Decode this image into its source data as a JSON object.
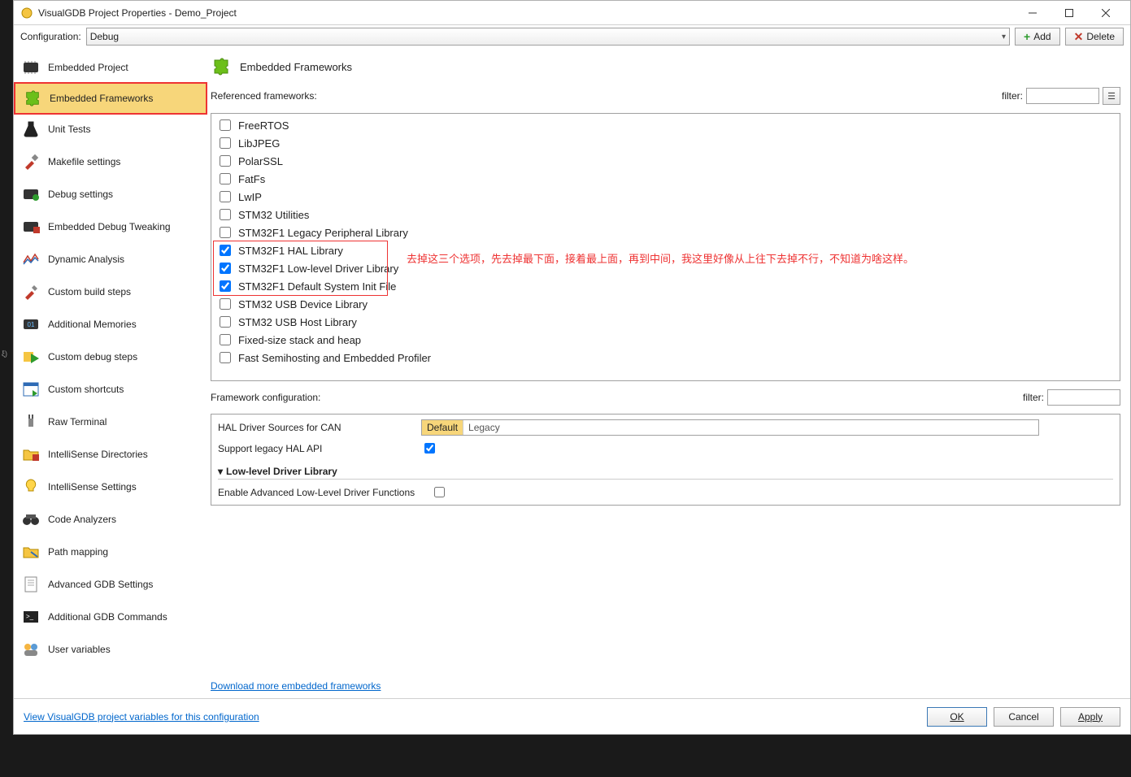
{
  "window": {
    "title": "VisualGDB Project Properties - Demo_Project"
  },
  "toolbar": {
    "config_label": "Configuration:",
    "config_value": "Debug",
    "add_label": "Add",
    "delete_label": "Delete"
  },
  "sidebar": {
    "items": [
      {
        "label": "Embedded Project",
        "icon": "chip"
      },
      {
        "label": "Embedded Frameworks",
        "icon": "puzzle",
        "selected": true
      },
      {
        "label": "Unit Tests",
        "icon": "flask"
      },
      {
        "label": "Makefile settings",
        "icon": "hammer"
      },
      {
        "label": "Debug settings",
        "icon": "bug"
      },
      {
        "label": "Embedded Debug Tweaking",
        "icon": "chip2"
      },
      {
        "label": "Dynamic Analysis",
        "icon": "chart"
      },
      {
        "label": "Custom build steps",
        "icon": "tools"
      },
      {
        "label": "Additional Memories",
        "icon": "mem"
      },
      {
        "label": "Custom debug steps",
        "icon": "play"
      },
      {
        "label": "Custom shortcuts",
        "icon": "window"
      },
      {
        "label": "Raw Terminal",
        "icon": "plug"
      },
      {
        "label": "IntelliSense Directories",
        "icon": "folder"
      },
      {
        "label": "IntelliSense Settings",
        "icon": "bulb"
      },
      {
        "label": "Code Analyzers",
        "icon": "binoc"
      },
      {
        "label": "Path mapping",
        "icon": "map"
      },
      {
        "label": "Advanced GDB Settings",
        "icon": "doc"
      },
      {
        "label": "Additional GDB Commands",
        "icon": "term"
      },
      {
        "label": "User variables",
        "icon": "users"
      }
    ]
  },
  "page": {
    "title": "Embedded Frameworks",
    "ref_label": "Referenced frameworks:",
    "filter_label": "filter:",
    "frameworks": [
      {
        "label": "FreeRTOS",
        "checked": false
      },
      {
        "label": "LibJPEG",
        "checked": false
      },
      {
        "label": "PolarSSL",
        "checked": false
      },
      {
        "label": "FatFs",
        "checked": false
      },
      {
        "label": "LwIP",
        "checked": false
      },
      {
        "label": "STM32 Utilities",
        "checked": false
      },
      {
        "label": "STM32F1 Legacy Peripheral Library",
        "checked": false
      },
      {
        "label": "STM32F1 HAL Library",
        "checked": true,
        "hl": true
      },
      {
        "label": "STM32F1 Low-level Driver Library",
        "checked": true,
        "hl": true
      },
      {
        "label": "STM32F1 Default System Init File",
        "checked": true,
        "hl": true
      },
      {
        "label": "STM32 USB Device Library",
        "checked": false
      },
      {
        "label": "STM32 USB Host Library",
        "checked": false
      },
      {
        "label": "Fixed-size stack and heap",
        "checked": false
      },
      {
        "label": "Fast Semihosting and Embedded Profiler",
        "checked": false
      }
    ],
    "annotation": "去掉这三个选项，先去掉最下面，接着最上面，再到中间，我这里好像从上往下去掉不行，不知道为啥这样。",
    "config_label": "Framework configuration:",
    "hal_sources_label": "HAL Driver Sources for CAN",
    "hal_sources_options": [
      "Default",
      "Legacy"
    ],
    "hal_sources_selected": "Default",
    "support_legacy_label": "Support legacy HAL API",
    "support_legacy_checked": true,
    "ll_section": "Low-level Driver Library",
    "ll_enable_label": "Enable Advanced Low-Level Driver Functions",
    "ll_enable_checked": false,
    "download_link": "Download more embedded frameworks"
  },
  "footer": {
    "vars_link": "View VisualGDB project variables for this configuration",
    "ok": "OK",
    "cancel": "Cancel",
    "apply": "Apply"
  }
}
